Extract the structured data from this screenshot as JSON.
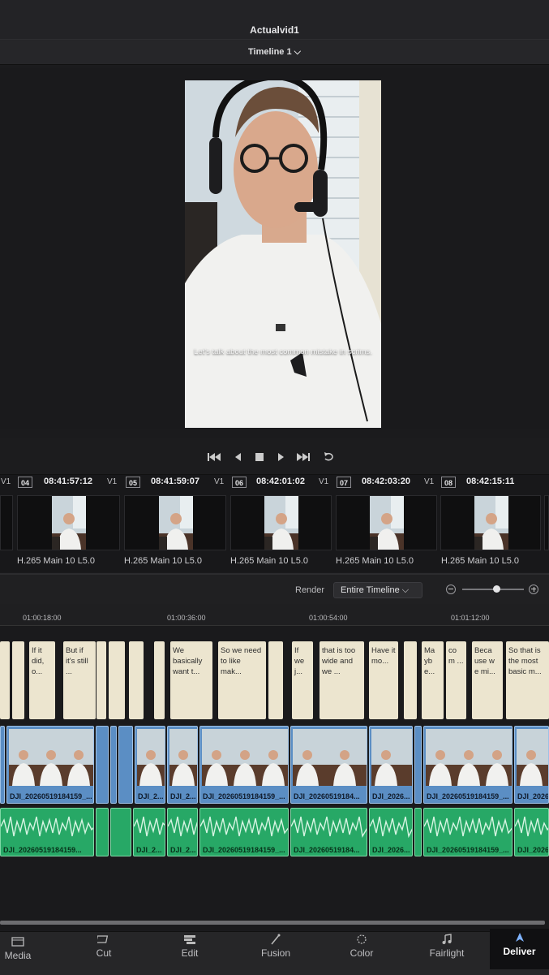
{
  "header": {
    "project_title": "Actualvid1",
    "timeline_name": "Timeline 1 ⌵"
  },
  "viewer": {
    "subtitle": "Let's talk about the most common mistake in scrims."
  },
  "clips": [
    {
      "track": "V1",
      "index": "04",
      "timecode": "08:41:57:12",
      "codec": "H.265 Main 10 L5.0"
    },
    {
      "track": "V1",
      "index": "05",
      "timecode": "08:41:59:07",
      "codec": "H.265 Main 10 L5.0"
    },
    {
      "track": "V1",
      "index": "06",
      "timecode": "08:42:01:02",
      "codec": "H.265 Main 10 L5.0"
    },
    {
      "track": "V1",
      "index": "07",
      "timecode": "08:42:03:20",
      "codec": "H.265 Main 10 L5.0"
    },
    {
      "track": "V1",
      "index": "08",
      "timecode": "08:42:15:11",
      "codec": "H.265 Main 10 L5.0"
    }
  ],
  "first_track_label": "V1",
  "render": {
    "label": "Render",
    "selected": "Entire Timeline ⌵"
  },
  "ruler": [
    "01:00:18:00",
    "01:00:36:00",
    "01:00:54:00",
    "01:01:12:00"
  ],
  "subtitle_clips": [
    "",
    "",
    "If it did, o...",
    "But if it's still ...",
    "",
    "",
    "",
    "We basically want t...",
    "So we need to like mak...",
    "",
    "If we j...",
    "that is too wide and we ...",
    "Have it mo...",
    "",
    "Ma yb e...",
    "co m ...",
    "Beca use w e mi...",
    "So that is the most basic m..."
  ],
  "video_clips": [
    "",
    "DJI_20260519184159_...",
    "",
    "",
    "",
    "DJI_2...",
    "DJI_2...",
    "DJI_20260519184159_...",
    "DJI_20260519184...",
    "DJI_2026...",
    "",
    "DJI_20260519184159_...",
    "DJI_2026..."
  ],
  "audio_clips": [
    "DJI_20260519184159...",
    "",
    "",
    "DJI_2...",
    "DJI_2...",
    "DJI_20260519184159_...",
    "DJI_20260519184...",
    "DJI_2026...",
    "",
    "DJI_20260519184159_...",
    "DJI_2026..."
  ],
  "pages": [
    {
      "label": "Media",
      "icon": "media-icon"
    },
    {
      "label": "Cut",
      "icon": "cut-icon"
    },
    {
      "label": "Edit",
      "icon": "edit-icon"
    },
    {
      "label": "Fusion",
      "icon": "fusion-icon"
    },
    {
      "label": "Color",
      "icon": "color-icon"
    },
    {
      "label": "Fairlight",
      "icon": "fairlight-icon"
    },
    {
      "label": "Deliver",
      "icon": "deliver-icon"
    }
  ],
  "colors": {
    "video_clip": "#5b8ec4",
    "audio_clip": "#27a866",
    "subtitle_clip": "#ece5cf"
  }
}
